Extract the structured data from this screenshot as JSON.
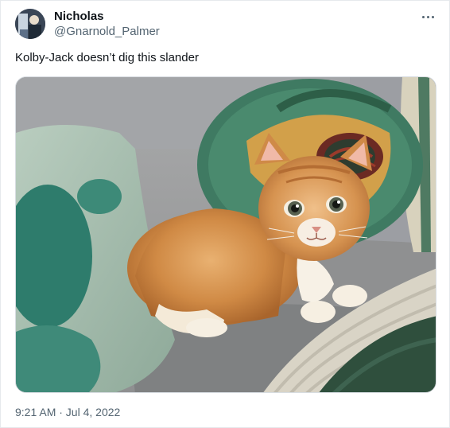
{
  "tweet": {
    "display_name": "Nicholas",
    "handle": "@Gnarnold_Palmer",
    "text": "Kolby-Jack doesn’t dig this slander",
    "timestamp": "9:21 AM · Jul 4, 2022"
  },
  "icons": {
    "more": "more-horizontal-icon",
    "avatar": "avatar-photo"
  },
  "colors": {
    "primary_text": "#0f1419",
    "secondary_text": "#536471",
    "border": "#e6e9ec"
  }
}
